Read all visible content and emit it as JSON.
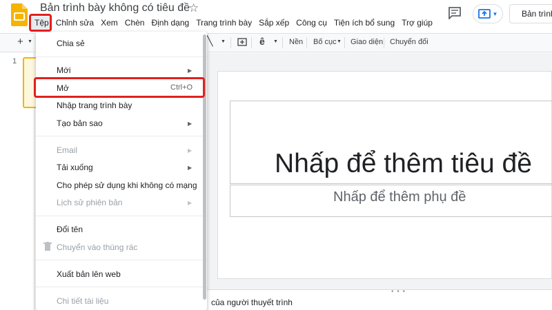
{
  "header": {
    "doc_title": "Bản trình bày không có tiêu đề",
    "slideshow_label": "Bản trình chiếu",
    "menu_items": [
      "Tệp",
      "Chỉnh sửa",
      "Xem",
      "Chèn",
      "Định dạng",
      "Trang trình bày",
      "Sắp xếp",
      "Công cụ",
      "Tiện ích bổ sung",
      "Trợ giúp"
    ],
    "active_menu": "Tệp"
  },
  "toolbar": {
    "add_label": "+",
    "background_label": "Nền",
    "layout_label": "Bố cục",
    "theme_label": "Giao diện",
    "transition_label": "Chuyển đổi"
  },
  "filmstrip": {
    "slide_number": "1"
  },
  "slide": {
    "title_placeholder": "Nhấp để thêm tiêu đề",
    "subtitle_placeholder": "Nhấp để thêm phụ đề"
  },
  "notes": {
    "placeholder": "của người thuyết trình"
  },
  "file_menu": {
    "share": "Chia sẻ",
    "new": "Mới",
    "open": "Mở",
    "open_shortcut": "Ctrl+O",
    "import_slides": "Nhập trang trình bày",
    "make_copy": "Tạo bản sao",
    "email": "Email",
    "download": "Tải xuống",
    "offline": "Cho phép sử dụng khi không có mạng",
    "version_history": "Lịch sử phiên bản",
    "rename": "Đổi tên",
    "move_to_trash": "Chuyển vào thùng rác",
    "publish_web": "Xuất bản lên web",
    "doc_details": "Chi tiết tài liệu"
  },
  "colors": {
    "accent": "#1a73e8",
    "logo": "#f4b400",
    "highlight": "#e0201e"
  }
}
